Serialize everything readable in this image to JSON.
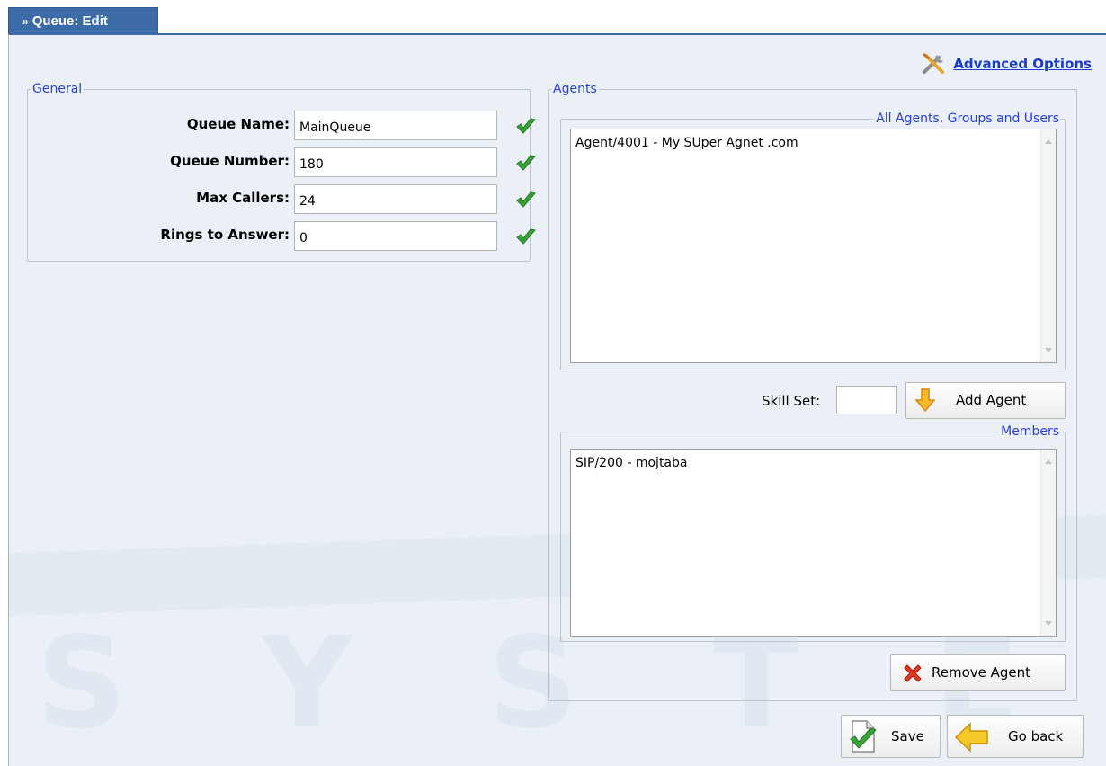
{
  "tab": {
    "title": "Queue: Edit",
    "prefix": "»"
  },
  "advanced_options": {
    "label": "Advanced Options",
    "icon": "tools-icon"
  },
  "general": {
    "legend": "General",
    "fields": [
      {
        "label": "Queue Name:",
        "value": "MainQueue"
      },
      {
        "label": "Queue Number:",
        "value": "180"
      },
      {
        "label": "Max Callers:",
        "value": "24"
      },
      {
        "label": "Rings to Answer:",
        "value": "0"
      }
    ]
  },
  "agents": {
    "legend": "Agents",
    "all_agents": {
      "legend": "All Agents, Groups and Users",
      "items": [
        "Agent/4001 - My SUper Agnet .com"
      ]
    },
    "skill_set_label": "Skill Set:",
    "skill_set_value": "",
    "add_agent_label": "Add Agent",
    "members": {
      "legend": "Members",
      "items": [
        "SIP/200 - mojtaba"
      ]
    },
    "remove_agent_label": "Remove Agent"
  },
  "footer": {
    "save_label": "Save",
    "go_back_label": "Go back"
  },
  "watermark": "SYSTEMS",
  "colors": {
    "tab_bg": "#3d6ba8",
    "panel_bg": "#eaf0f5",
    "legend_text": "#2b3fd6",
    "link": "#1a3cc8",
    "ok_green": "#3aa335"
  }
}
